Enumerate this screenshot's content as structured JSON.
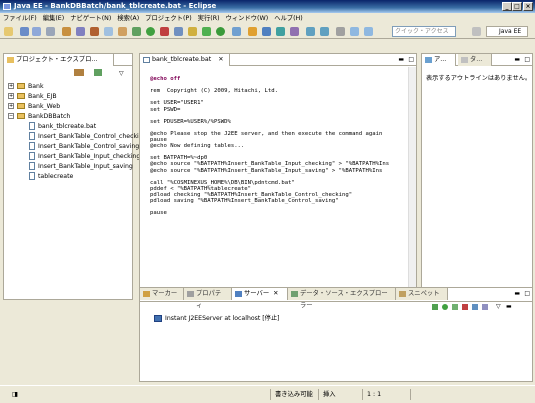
{
  "window": {
    "title": "Java EE - BankDBBatch/bank_tblcreate.bat - Eclipse"
  },
  "menu": [
    "ファイル(F)",
    "編集(E)",
    "ナビゲート(N)",
    "検索(A)",
    "プロジェクト(P)",
    "実行(R)",
    "ウィンドウ(W)",
    "ヘルプ(H)"
  ],
  "toolbar": {
    "search_placeholder": "クイック・アクセス",
    "perspective_label": "Java EE"
  },
  "explorer": {
    "tab_label": "プロジェクト・エクスプロ...",
    "items": [
      {
        "label": "Bank",
        "type": "project"
      },
      {
        "label": "Bank_EJB",
        "type": "project"
      },
      {
        "label": "Bank_Web",
        "type": "project"
      },
      {
        "label": "BankDBBatch",
        "type": "project"
      },
      {
        "label": "bank_tblcreate.bat",
        "type": "file"
      },
      {
        "label": "Insert_BankTable_Control_checkin",
        "type": "file"
      },
      {
        "label": "Insert_BankTable_Control_saving",
        "type": "file"
      },
      {
        "label": "Insert_BankTable_Input_checking",
        "type": "file"
      },
      {
        "label": "Insert_BankTable_Input_saving",
        "type": "file"
      },
      {
        "label": "tablecreate",
        "type": "file"
      }
    ]
  },
  "editor": {
    "tab_label": "bank_tblcreate.bat",
    "lines": [
      "@echo off",
      "",
      "rem  Copyright (C) 2009, Hitachi, Ltd.",
      "",
      "set USER=\"USER1\"",
      "set PSWD=",
      "",
      "set PDUSER=%USER%/%PSWD%",
      "",
      "@echo Please stop the J2EE server, and then execute the command again",
      "pause",
      "@echo Now defining tables...",
      "",
      "set BATPATH=%~dp0",
      "@echo source \"%BATPATH%Insert_BankTable_Input_checking\" > \"%BATPATH%Ins",
      "@echo source \"%BATPATH%Insert_BankTable_Input_saving\" > \"%BATPATH%Ins",
      "",
      "call \"%COSMINEXUS_HOME%\\DB\\BIN\\pdntcmd.bat\"",
      "pddef < \"%BATPATH%tablecreate\"",
      "pdload checking \"%BATPATH%Insert_BankTable_Control_checking\"",
      "pdload saving \"%BATPATH%Insert_BankTable_Control_saving\"",
      "",
      "pause"
    ]
  },
  "outline": {
    "tab_label": "ア...",
    "tab2_label": "タ...",
    "message": "表示するアウトラインはありません。"
  },
  "bottom": {
    "tabs": [
      "マーカー",
      "プロパティ",
      "サーバー",
      "データ・ソース・エクスプローラー",
      "スニペット"
    ],
    "server_entry": "Instant J2EEServer at localhost  [停止]"
  },
  "status": {
    "writable": "書き込み可能",
    "insert_mode": "挿入",
    "position": "1 : 1"
  }
}
